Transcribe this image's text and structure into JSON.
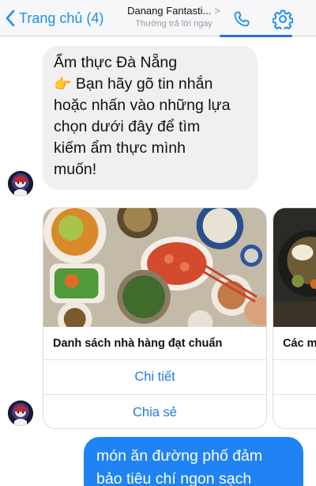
{
  "header": {
    "back_label": "Trang chủ (4)",
    "chat_name": "Danang Fantasti...",
    "chat_chevron": ">",
    "status": "Thường trả lời ngay",
    "accent_color": "#1d8ff3"
  },
  "messages": {
    "incoming_lines": [
      "Ẩm thực Đà Nẵng",
      "Bạn hãy gõ tin nhắn",
      "hoặc nhấn vào những lựa",
      "chọn dưới đây để tìm",
      "kiếm ẩm thực mình",
      "muốn!"
    ],
    "pointing_emoji": "👉",
    "outgoing_lines": [
      "món ăn đường phố đảm",
      "bảo tiêu chí ngon sạch"
    ]
  },
  "cards": [
    {
      "title": "Danh sách nhà hàng đạt chuẩn",
      "buttons": [
        "Chi tiết",
        "Chia sẻ"
      ]
    },
    {
      "title": "Các m"
    }
  ],
  "icons": {
    "back": "chevron-left-icon",
    "phone": "phone-icon",
    "settings": "gear-icon"
  }
}
